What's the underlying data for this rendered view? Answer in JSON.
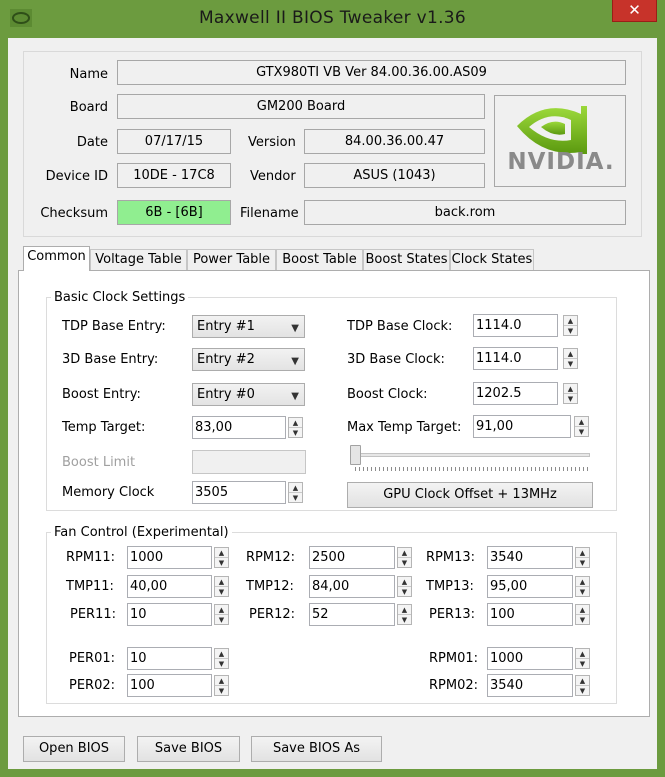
{
  "window": {
    "title": "Maxwell II BIOS Tweaker v1.36",
    "close_glyph": "✕"
  },
  "header": {
    "name_label": "Name",
    "name_value": "GTX980TI VB Ver 84.00.36.00.AS09",
    "board_label": "Board",
    "board_value": "GM200 Board",
    "date_label": "Date",
    "date_value": "07/17/15",
    "version_label": "Version",
    "version_value": "84.00.36.00.47",
    "device_label": "Device ID",
    "device_value": "10DE - 17C8",
    "vendor_label": "Vendor",
    "vendor_value": "ASUS (1043)",
    "checksum_label": "Checksum",
    "checksum_value": "6B - [6B]",
    "filename_label": "Filename",
    "filename_value": "back.rom",
    "logo_text": "NVIDIA.",
    "checksum_color": "#90ee90"
  },
  "tabs": [
    {
      "label": "Common"
    },
    {
      "label": "Voltage Table"
    },
    {
      "label": "Power Table"
    },
    {
      "label": "Boost Table"
    },
    {
      "label": "Boost States"
    },
    {
      "label": "Clock States"
    }
  ],
  "basic": {
    "title": "Basic Clock Settings",
    "tdp_base_entry_label": "TDP Base Entry:",
    "tdp_base_entry_value": "Entry #1",
    "base3d_entry_label": "3D Base Entry:",
    "base3d_entry_value": "Entry #2",
    "boost_entry_label": "Boost Entry:",
    "boost_entry_value": "Entry #0",
    "temp_target_label": "Temp Target:",
    "temp_target_value": "83,00",
    "boost_limit_label": "Boost Limit",
    "memory_clock_label": "Memory Clock",
    "memory_clock_value": "3505",
    "tdp_base_clock_label": "TDP Base Clock:",
    "tdp_base_clock_value": "1114.0",
    "base3d_clock_label": "3D Base Clock:",
    "base3d_clock_value": "1114.0",
    "boost_clock_label": "Boost Clock:",
    "boost_clock_value": "1202.5",
    "max_temp_label": "Max Temp Target:",
    "max_temp_value": "91,00",
    "offset_button": "GPU Clock Offset + 13MHz"
  },
  "fan": {
    "title": "Fan Control (Experimental)",
    "rpm11_label": "RPM11:",
    "rpm11": "1000",
    "rpm12_label": "RPM12:",
    "rpm12": "2500",
    "rpm13_label": "RPM13:",
    "rpm13": "3540",
    "tmp11_label": "TMP11:",
    "tmp11": "40,00",
    "tmp12_label": "TMP12:",
    "tmp12": "84,00",
    "tmp13_label": "TMP13:",
    "tmp13": "95,00",
    "per11_label": "PER11:",
    "per11": "10",
    "per12_label": "PER12:",
    "per12": "52",
    "per13_label": "PER13:",
    "per13": "100",
    "per01_label": "PER01:",
    "per01": "10",
    "per02_label": "PER02:",
    "per02": "100",
    "rpm01_label": "RPM01:",
    "rpm01": "1000",
    "rpm02_label": "RPM02:",
    "rpm02": "3540"
  },
  "footer": {
    "open": "Open BIOS",
    "save": "Save BIOS",
    "save_as": "Save BIOS As"
  },
  "glyphs": {
    "up": "▲",
    "down": "▼",
    "dropdown": "▼"
  },
  "colors": {
    "frame": "#6c9b3f",
    "close": "#c7332a",
    "nvidia_green": "#76b900"
  }
}
